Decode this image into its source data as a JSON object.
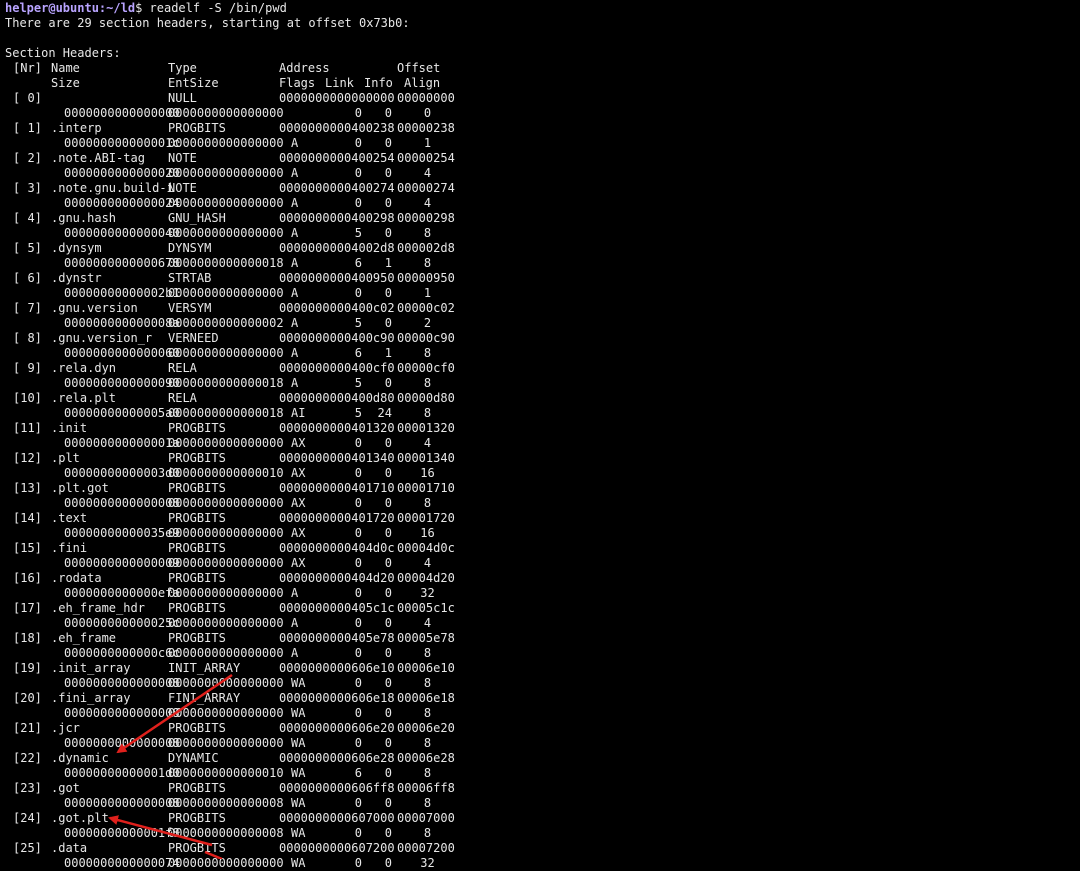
{
  "prompt": {
    "user": "helper@ubuntu",
    "sep": ":",
    "path": "~/ld",
    "symbol": "$",
    "command": " readelf -S /bin/pwd"
  },
  "summary_line": "There are 29 section headers, starting at offset 0x73b0:",
  "section_title": "Section Headers:",
  "header1": {
    "nr": "[Nr]",
    "name": "Name",
    "type": "Type",
    "address": "Address",
    "offset": "Offset"
  },
  "header2": {
    "size": "Size",
    "entsize": "EntSize",
    "flags": "Flags",
    "link": "Link",
    "info": "Info",
    "align": "Align"
  },
  "sections": [
    {
      "nr": "[ 0]",
      "name": "",
      "type": "NULL",
      "address": "0000000000000000",
      "offset": "00000000",
      "size": "0000000000000000",
      "entsize": "0000000000000000",
      "flags": "",
      "link": "0",
      "info": "0",
      "align": "0"
    },
    {
      "nr": "[ 1]",
      "name": ".interp",
      "type": "PROGBITS",
      "address": "0000000000400238",
      "offset": "00000238",
      "size": "000000000000001c",
      "entsize": "0000000000000000",
      "flags": "A",
      "link": "0",
      "info": "0",
      "align": "1"
    },
    {
      "nr": "[ 2]",
      "name": ".note.ABI-tag",
      "type": "NOTE",
      "address": "0000000000400254",
      "offset": "00000254",
      "size": "0000000000000020",
      "entsize": "0000000000000000",
      "flags": "A",
      "link": "0",
      "info": "0",
      "align": "4"
    },
    {
      "nr": "[ 3]",
      "name": ".note.gnu.build-i",
      "type": "NOTE",
      "address": "0000000000400274",
      "offset": "00000274",
      "size": "0000000000000024",
      "entsize": "0000000000000000",
      "flags": "A",
      "link": "0",
      "info": "0",
      "align": "4"
    },
    {
      "nr": "[ 4]",
      "name": ".gnu.hash",
      "type": "GNU_HASH",
      "address": "0000000000400298",
      "offset": "00000298",
      "size": "0000000000000040",
      "entsize": "0000000000000000",
      "flags": "A",
      "link": "5",
      "info": "0",
      "align": "8"
    },
    {
      "nr": "[ 5]",
      "name": ".dynsym",
      "type": "DYNSYM",
      "address": "00000000004002d8",
      "offset": "000002d8",
      "size": "0000000000000678",
      "entsize": "0000000000000018",
      "flags": "A",
      "link": "6",
      "info": "1",
      "align": "8"
    },
    {
      "nr": "[ 6]",
      "name": ".dynstr",
      "type": "STRTAB",
      "address": "0000000000400950",
      "offset": "00000950",
      "size": "00000000000002b1",
      "entsize": "0000000000000000",
      "flags": "A",
      "link": "0",
      "info": "0",
      "align": "1"
    },
    {
      "nr": "[ 7]",
      "name": ".gnu.version",
      "type": "VERSYM",
      "address": "0000000000400c02",
      "offset": "00000c02",
      "size": "000000000000008a",
      "entsize": "0000000000000002",
      "flags": "A",
      "link": "5",
      "info": "0",
      "align": "2"
    },
    {
      "nr": "[ 8]",
      "name": ".gnu.version_r",
      "type": "VERNEED",
      "address": "0000000000400c90",
      "offset": "00000c90",
      "size": "0000000000000060",
      "entsize": "0000000000000000",
      "flags": "A",
      "link": "6",
      "info": "1",
      "align": "8"
    },
    {
      "nr": "[ 9]",
      "name": ".rela.dyn",
      "type": "RELA",
      "address": "0000000000400cf0",
      "offset": "00000cf0",
      "size": "0000000000000090",
      "entsize": "0000000000000018",
      "flags": "A",
      "link": "5",
      "info": "0",
      "align": "8"
    },
    {
      "nr": "[10]",
      "name": ".rela.plt",
      "type": "RELA",
      "address": "0000000000400d80",
      "offset": "00000d80",
      "size": "00000000000005a0",
      "entsize": "0000000000000018",
      "flags": "AI",
      "link": "5",
      "info": "24",
      "align": "8"
    },
    {
      "nr": "[11]",
      "name": ".init",
      "type": "PROGBITS",
      "address": "0000000000401320",
      "offset": "00001320",
      "size": "000000000000001a",
      "entsize": "0000000000000000",
      "flags": "AX",
      "link": "0",
      "info": "0",
      "align": "4"
    },
    {
      "nr": "[12]",
      "name": ".plt",
      "type": "PROGBITS",
      "address": "0000000000401340",
      "offset": "00001340",
      "size": "00000000000003d0",
      "entsize": "0000000000000010",
      "flags": "AX",
      "link": "0",
      "info": "0",
      "align": "16"
    },
    {
      "nr": "[13]",
      "name": ".plt.got",
      "type": "PROGBITS",
      "address": "0000000000401710",
      "offset": "00001710",
      "size": "0000000000000008",
      "entsize": "0000000000000000",
      "flags": "AX",
      "link": "0",
      "info": "0",
      "align": "8"
    },
    {
      "nr": "[14]",
      "name": ".text",
      "type": "PROGBITS",
      "address": "0000000000401720",
      "offset": "00001720",
      "size": "00000000000035e9",
      "entsize": "0000000000000000",
      "flags": "AX",
      "link": "0",
      "info": "0",
      "align": "16"
    },
    {
      "nr": "[15]",
      "name": ".fini",
      "type": "PROGBITS",
      "address": "0000000000404d0c",
      "offset": "00004d0c",
      "size": "0000000000000009",
      "entsize": "0000000000000000",
      "flags": "AX",
      "link": "0",
      "info": "0",
      "align": "4"
    },
    {
      "nr": "[16]",
      "name": ".rodata",
      "type": "PROGBITS",
      "address": "0000000000404d20",
      "offset": "00004d20",
      "size": "0000000000000efa",
      "entsize": "0000000000000000",
      "flags": "A",
      "link": "0",
      "info": "0",
      "align": "32"
    },
    {
      "nr": "[17]",
      "name": ".eh_frame_hdr",
      "type": "PROGBITS",
      "address": "0000000000405c1c",
      "offset": "00005c1c",
      "size": "000000000000025c",
      "entsize": "0000000000000000",
      "flags": "A",
      "link": "0",
      "info": "0",
      "align": "4"
    },
    {
      "nr": "[18]",
      "name": ".eh_frame",
      "type": "PROGBITS",
      "address": "0000000000405e78",
      "offset": "00005e78",
      "size": "0000000000000c6c",
      "entsize": "0000000000000000",
      "flags": "A",
      "link": "0",
      "info": "0",
      "align": "8"
    },
    {
      "nr": "[19]",
      "name": ".init_array",
      "type": "INIT_ARRAY",
      "address": "0000000000606e10",
      "offset": "00006e10",
      "size": "0000000000000008",
      "entsize": "0000000000000000",
      "flags": "WA",
      "link": "0",
      "info": "0",
      "align": "8"
    },
    {
      "nr": "[20]",
      "name": ".fini_array",
      "type": "FINI_ARRAY",
      "address": "0000000000606e18",
      "offset": "00006e18",
      "size": "0000000000000008",
      "entsize": "0000000000000000",
      "flags": "WA",
      "link": "0",
      "info": "0",
      "align": "8"
    },
    {
      "nr": "[21]",
      "name": ".jcr",
      "type": "PROGBITS",
      "address": "0000000000606e20",
      "offset": "00006e20",
      "size": "0000000000000008",
      "entsize": "0000000000000000",
      "flags": "WA",
      "link": "0",
      "info": "0",
      "align": "8"
    },
    {
      "nr": "[22]",
      "name": ".dynamic",
      "type": "DYNAMIC",
      "address": "0000000000606e28",
      "offset": "00006e28",
      "size": "00000000000001d0",
      "entsize": "0000000000000010",
      "flags": "WA",
      "link": "6",
      "info": "0",
      "align": "8"
    },
    {
      "nr": "[23]",
      "name": ".got",
      "type": "PROGBITS",
      "address": "0000000000606ff8",
      "offset": "00006ff8",
      "size": "0000000000000008",
      "entsize": "0000000000000008",
      "flags": "WA",
      "link": "0",
      "info": "0",
      "align": "8"
    },
    {
      "nr": "[24]",
      "name": ".got.plt",
      "type": "PROGBITS",
      "address": "0000000000607000",
      "offset": "00007000",
      "size": "00000000000001f8",
      "entsize": "0000000000000008",
      "flags": "WA",
      "link": "0",
      "info": "0",
      "align": "8"
    },
    {
      "nr": "[25]",
      "name": ".data",
      "type": "PROGBITS",
      "address": "0000000000607200",
      "offset": "00007200",
      "size": "0000000000000074",
      "entsize": "0000000000000000",
      "flags": "WA",
      "link": "0",
      "info": "0",
      "align": "32"
    }
  ],
  "annotation_color": "#e0201c"
}
